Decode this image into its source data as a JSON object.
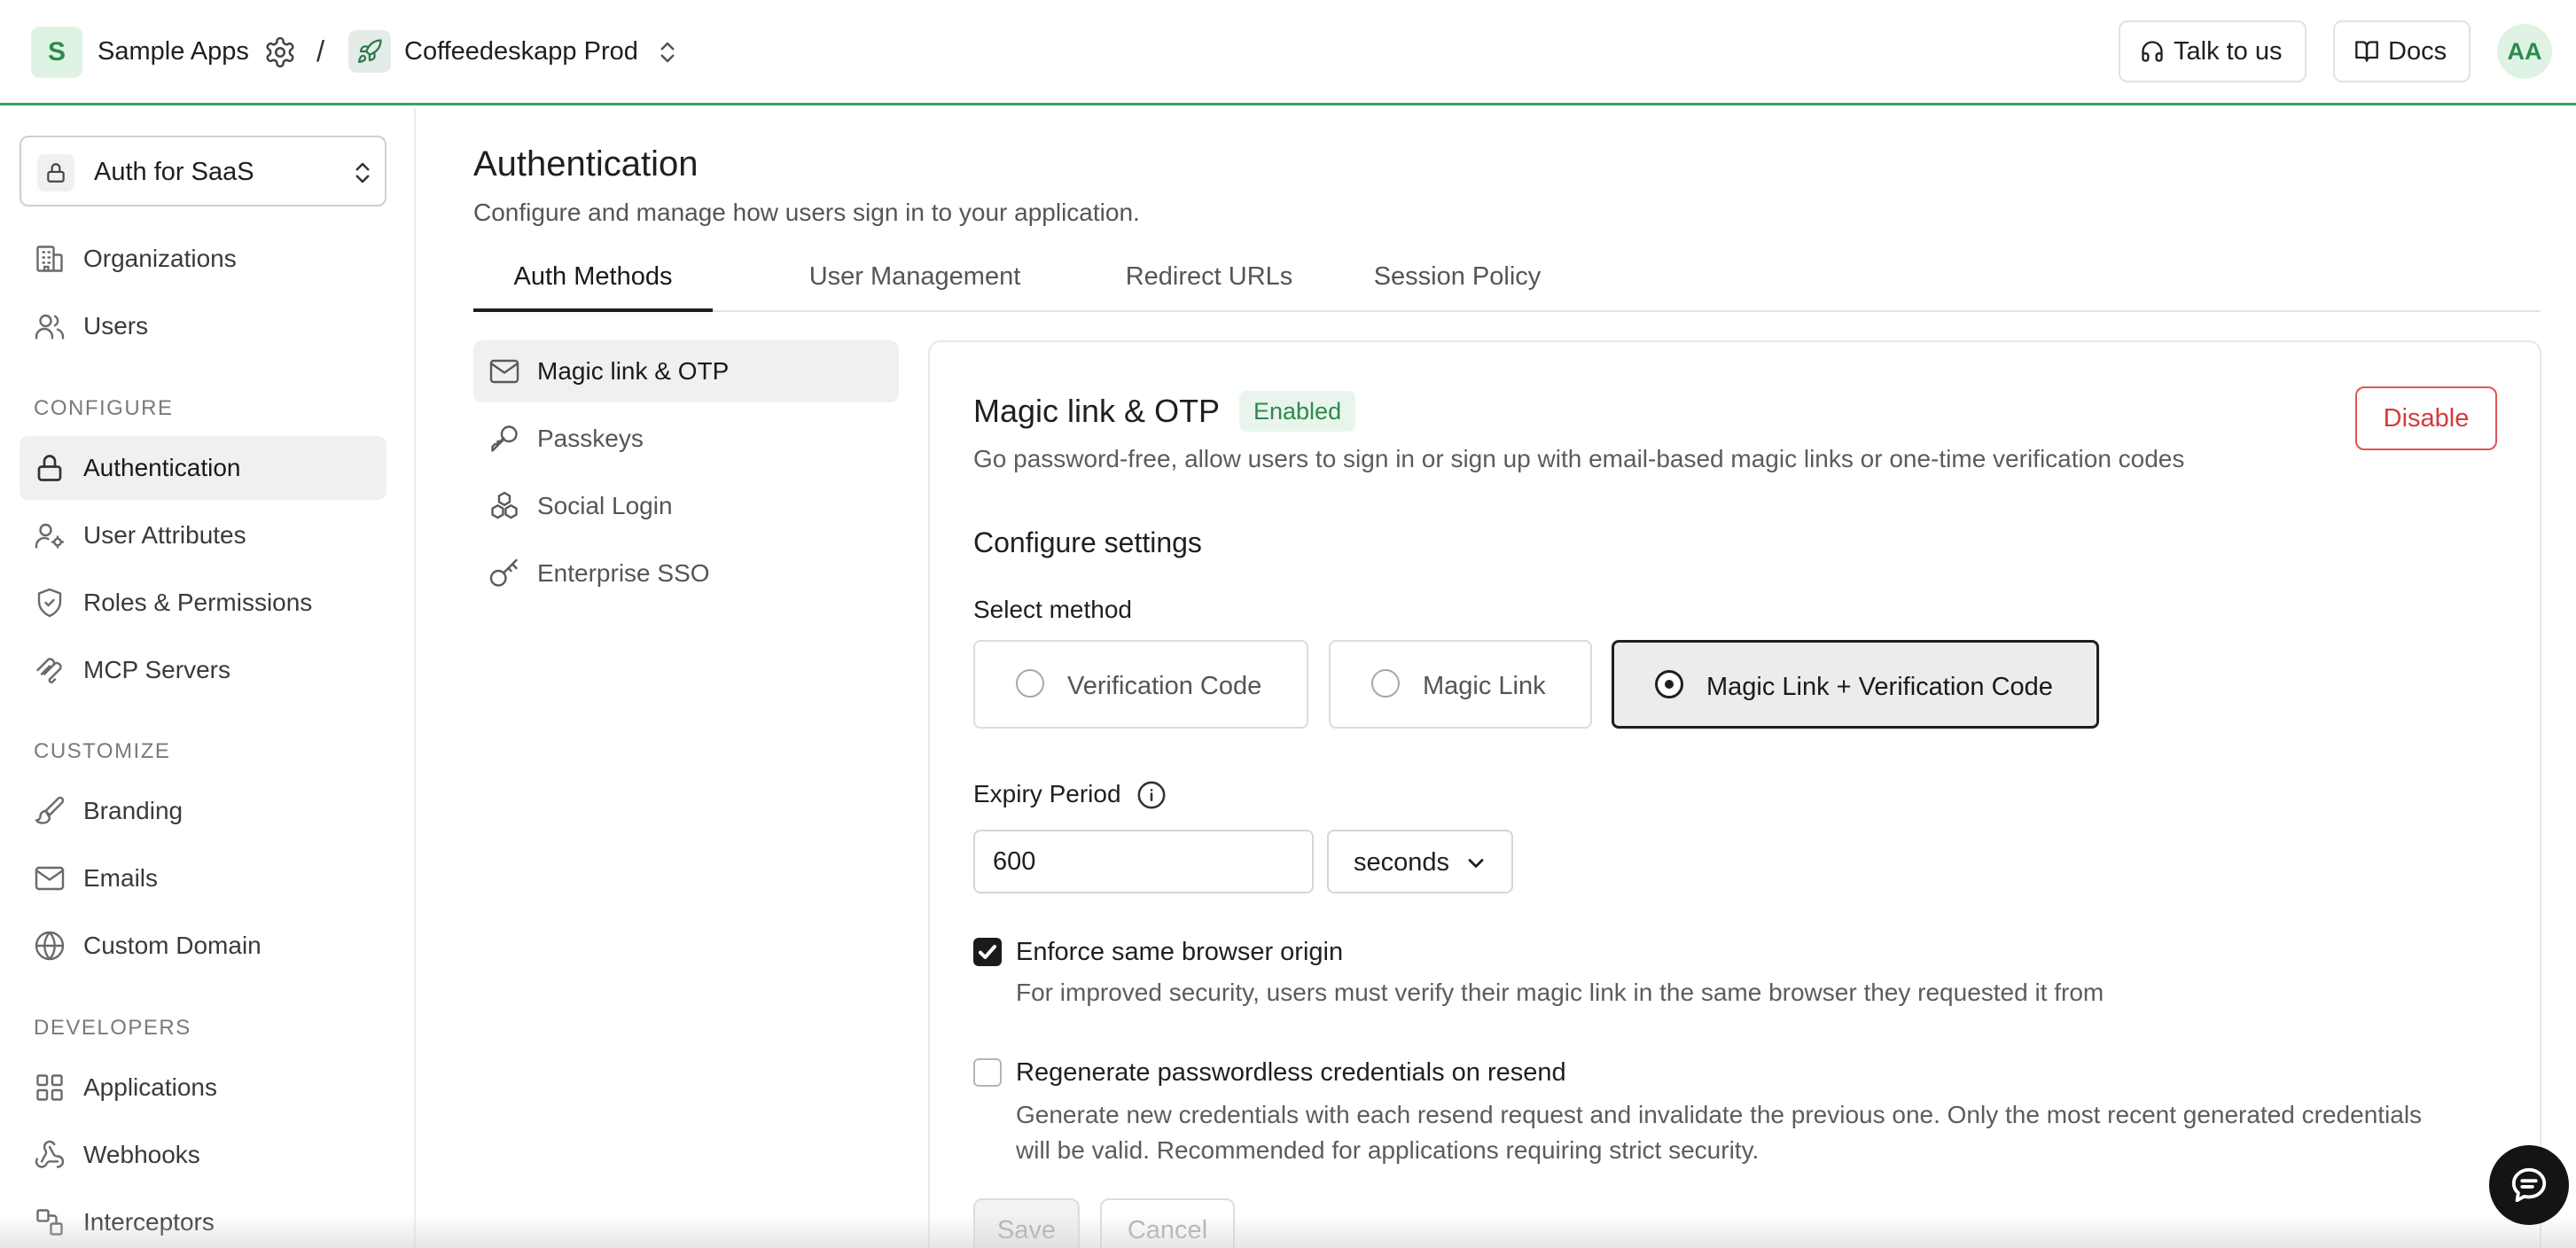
{
  "topbar": {
    "org_initial": "S",
    "org_name": "Sample Apps",
    "separator": "/",
    "project_name": "Coffeedeskapp Prod",
    "talk_label": "Talk to us",
    "docs_label": "Docs",
    "avatar_initials": "AA",
    "accent_color": "#3e9f61"
  },
  "sidebar": {
    "app_selector": "Auth for SaaS",
    "top_items": [
      {
        "label": "Organizations",
        "icon": "building-icon"
      },
      {
        "label": "Users",
        "icon": "users-icon"
      }
    ],
    "sections": [
      {
        "heading": "CONFIGURE",
        "items": [
          {
            "label": "Authentication",
            "icon": "lock-icon",
            "active": true
          },
          {
            "label": "User Attributes",
            "icon": "user-attributes-icon"
          },
          {
            "label": "Roles & Permissions",
            "icon": "shield-icon"
          },
          {
            "label": "MCP Servers",
            "icon": "mcp-icon"
          }
        ]
      },
      {
        "heading": "CUSTOMIZE",
        "items": [
          {
            "label": "Branding",
            "icon": "paintbrush-icon"
          },
          {
            "label": "Emails",
            "icon": "mail-icon"
          },
          {
            "label": "Custom Domain",
            "icon": "globe-icon"
          }
        ]
      },
      {
        "heading": "DEVELOPERS",
        "items": [
          {
            "label": "Applications",
            "icon": "grid-icon"
          },
          {
            "label": "Webhooks",
            "icon": "webhook-icon"
          },
          {
            "label": "Interceptors",
            "icon": "interceptor-icon"
          }
        ]
      }
    ]
  },
  "main": {
    "title": "Authentication",
    "subtitle": "Configure and manage how users sign in to your application.",
    "tabs": [
      {
        "label": "Auth Methods",
        "active": true
      },
      {
        "label": "User Management"
      },
      {
        "label": "Redirect URLs"
      },
      {
        "label": "Session Policy"
      }
    ],
    "methods": [
      {
        "label": "Magic link & OTP",
        "icon": "mail-icon",
        "active": true
      },
      {
        "label": "Passkeys",
        "icon": "key-icon"
      },
      {
        "label": "Social Login",
        "icon": "social-icon"
      },
      {
        "label": "Enterprise SSO",
        "icon": "key-round-icon"
      }
    ]
  },
  "card": {
    "title": "Magic link & OTP",
    "status": "Enabled",
    "status_color": "#2c8a4c",
    "disable_label": "Disable",
    "disable_color": "#d63a3a",
    "description": "Go password-free, allow users to sign in or sign up with email-based magic links or one-time verification codes",
    "config_title": "Configure settings",
    "select_method_label": "Select method",
    "methods": [
      {
        "label": "Verification Code",
        "selected": false
      },
      {
        "label": "Magic Link",
        "selected": false
      },
      {
        "label": "Magic Link + Verification Code",
        "selected": true
      }
    ],
    "expiry_label": "Expiry Period",
    "expiry_value": "600",
    "expiry_unit": "seconds",
    "enforce_label": "Enforce same browser origin",
    "enforce_checked": true,
    "enforce_desc": "For improved security, users must verify their magic link in the same browser they requested it from",
    "regenerate_label": "Regenerate passwordless credentials on resend",
    "regenerate_checked": false,
    "regenerate_desc_line1": "Generate new credentials with each resend request and invalidate the previous one. Only the most recent generated credentials",
    "regenerate_desc_line2": "will be valid. Recommended for applications requiring strict security.",
    "save_label": "Save",
    "cancel_label": "Cancel"
  }
}
